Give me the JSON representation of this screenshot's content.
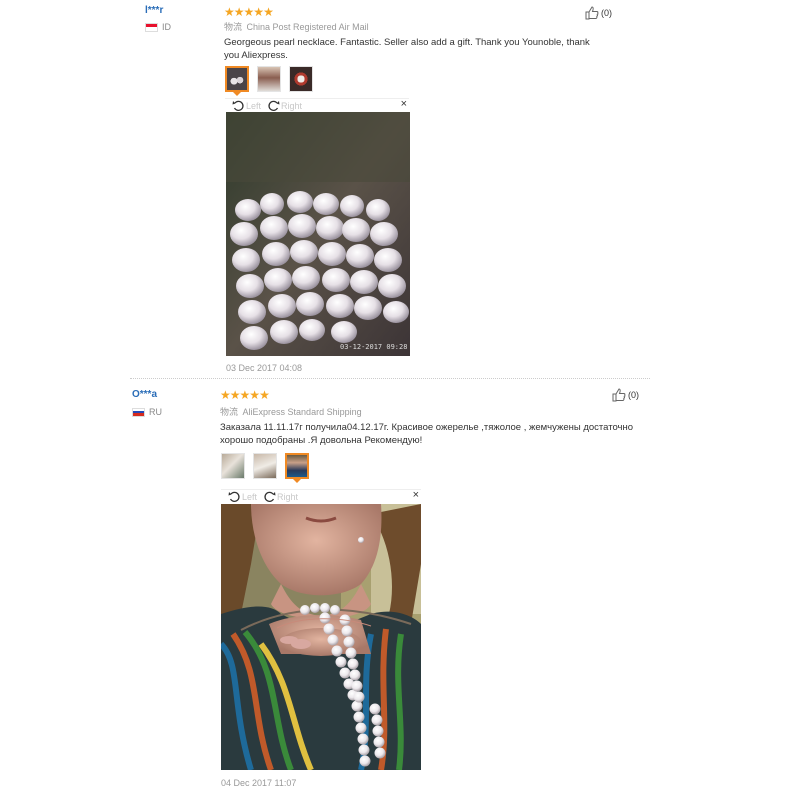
{
  "reviews": [
    {
      "user": "l***r",
      "country": "ID",
      "rating": 5,
      "shipping_prefix": "物流",
      "shipping": "China Post Registered Air Mail",
      "helpful_count": "(0)",
      "text": "Georgeous pearl necklace. Fantastic. Seller also add a gift. Thank you Younoble, thank you Aliexpress.",
      "viewer": {
        "left": "Left",
        "right": "Right",
        "close": "×"
      },
      "photo_stamp": "03-12-2017 09:28",
      "date": "03 Dec 2017 04:08"
    },
    {
      "user": "O***a",
      "country": "RU",
      "rating": 5,
      "shipping_prefix": "物流",
      "shipping": "AliExpress Standard Shipping",
      "helpful_count": "(0)",
      "text": "Заказала 11.11.17г получила04.12.17г. Красивое ожерелье ,тяжолое , жемчужены достаточно хорошо подобраны .Я довольна Рекомендую!",
      "viewer": {
        "left": "Left",
        "right": "Right",
        "close": "×"
      },
      "date": "04 Dec 2017 11:07"
    }
  ],
  "colors": {
    "star": "#f5a623",
    "link": "#2a6db8",
    "accent": "#f08a24"
  }
}
